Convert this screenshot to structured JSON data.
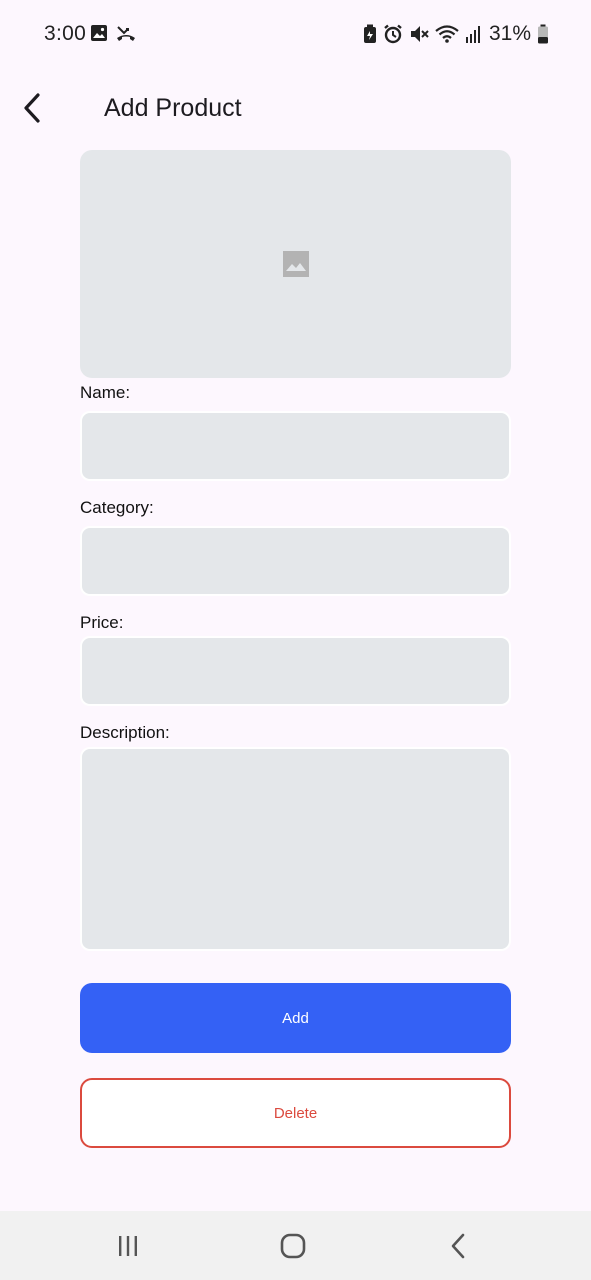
{
  "status_bar": {
    "time": "3:00",
    "battery_percent": "31%",
    "left_icons": [
      "image-icon",
      "missed-call-icon"
    ],
    "right_icons": [
      "battery-saver-icon",
      "alarm-icon",
      "mute-icon",
      "wifi-icon",
      "signal-icon",
      "battery-icon"
    ]
  },
  "app_bar": {
    "title": "Add Product",
    "back_icon": "chevron-left-icon"
  },
  "form": {
    "image_placeholder_icon": "image-placeholder-icon",
    "name_label": "Name:",
    "name_value": "",
    "category_label": "Category:",
    "category_value": "",
    "price_label": "Price:",
    "price_value": "",
    "description_label": "Description:",
    "description_value": ""
  },
  "actions": {
    "add_label": "Add",
    "delete_label": "Delete"
  },
  "nav_bar": {
    "icons": [
      "recent-apps-icon",
      "home-icon",
      "back-icon"
    ]
  },
  "colors": {
    "background": "#FDF7FE",
    "field_fill": "#E4E7EA",
    "primary": "#3461F5",
    "danger": "#DB4A3E"
  }
}
